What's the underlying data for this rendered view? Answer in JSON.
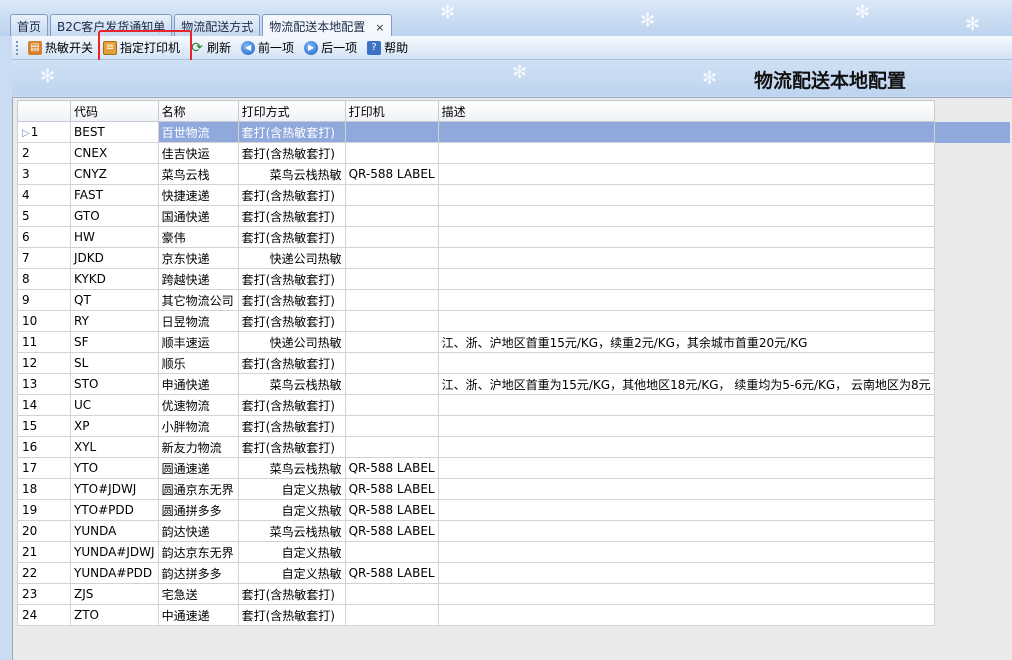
{
  "tabs": [
    {
      "label": "首页"
    },
    {
      "label": "B2C客户发货通知单"
    },
    {
      "label": "物流配送方式"
    },
    {
      "label": "物流配送本地配置",
      "active": true
    }
  ],
  "close_glyph": "×",
  "toolbar": {
    "hot_switch": "热敏开关",
    "assign_printer": "指定打印机",
    "refresh": "刷新",
    "prev": "前一项",
    "next": "后一项",
    "help": "帮助"
  },
  "page_title": "物流配送本地配置",
  "grid": {
    "columns": [
      "代码",
      "名称",
      "打印方式",
      "打印机",
      "描述"
    ],
    "selected_index": 0,
    "rows": [
      {
        "n": "1",
        "code": "BEST",
        "name": "百世物流",
        "method": "套打(含热敏套打)",
        "printer": "",
        "desc": ""
      },
      {
        "n": "2",
        "code": "CNEX",
        "name": "佳吉快运",
        "method": "套打(含热敏套打)",
        "printer": "",
        "desc": ""
      },
      {
        "n": "3",
        "code": "CNYZ",
        "name": "菜鸟云栈",
        "method": "菜鸟云栈热敏",
        "printer": "QR-588 LABEL",
        "desc": ""
      },
      {
        "n": "4",
        "code": "FAST",
        "name": "快捷速递",
        "method": "套打(含热敏套打)",
        "printer": "",
        "desc": ""
      },
      {
        "n": "5",
        "code": "GTO",
        "name": "国通快递",
        "method": "套打(含热敏套打)",
        "printer": "",
        "desc": ""
      },
      {
        "n": "6",
        "code": "HW",
        "name": "豪伟",
        "method": "套打(含热敏套打)",
        "printer": "",
        "desc": ""
      },
      {
        "n": "7",
        "code": "JDKD",
        "name": "京东快递",
        "method": "快递公司热敏",
        "printer": "",
        "desc": ""
      },
      {
        "n": "8",
        "code": "KYKD",
        "name": "跨越快递",
        "method": "套打(含热敏套打)",
        "printer": "",
        "desc": ""
      },
      {
        "n": "9",
        "code": "QT",
        "name": "其它物流公司",
        "method": "套打(含热敏套打)",
        "printer": "",
        "desc": ""
      },
      {
        "n": "10",
        "code": "RY",
        "name": "日昱物流",
        "method": "套打(含热敏套打)",
        "printer": "",
        "desc": ""
      },
      {
        "n": "11",
        "code": "SF",
        "name": "顺丰速运",
        "method": "快递公司热敏",
        "printer": "",
        "desc": "江、浙、沪地区首重15元/KG，续重2元/KG，其余城市首重20元/KG"
      },
      {
        "n": "12",
        "code": "SL",
        "name": "顺乐",
        "method": "套打(含热敏套打)",
        "printer": "",
        "desc": ""
      },
      {
        "n": "13",
        "code": "STO",
        "name": "申通快递",
        "method": "菜鸟云栈热敏",
        "printer": "",
        "desc": "江、浙、沪地区首重为15元/KG，其他地区18元/KG， 续重均为5-6元/KG， 云南地区为8元"
      },
      {
        "n": "14",
        "code": "UC",
        "name": "优速物流",
        "method": "套打(含热敏套打)",
        "printer": "",
        "desc": ""
      },
      {
        "n": "15",
        "code": "XP",
        "name": "小胖物流",
        "method": "套打(含热敏套打)",
        "printer": "",
        "desc": ""
      },
      {
        "n": "16",
        "code": "XYL",
        "name": "新友力物流",
        "method": "套打(含热敏套打)",
        "printer": "",
        "desc": ""
      },
      {
        "n": "17",
        "code": "YTO",
        "name": "圆通速递",
        "method": "菜鸟云栈热敏",
        "printer": "QR-588 LABEL",
        "desc": ""
      },
      {
        "n": "18",
        "code": "YTO#JDWJ",
        "name": "圆通京东无界",
        "method": "自定义热敏",
        "printer": "QR-588 LABEL",
        "desc": ""
      },
      {
        "n": "19",
        "code": "YTO#PDD",
        "name": "圆通拼多多",
        "method": "自定义热敏",
        "printer": "QR-588 LABEL",
        "desc": ""
      },
      {
        "n": "20",
        "code": "YUNDA",
        "name": "韵达快递",
        "method": "菜鸟云栈热敏",
        "printer": "QR-588 LABEL",
        "desc": ""
      },
      {
        "n": "21",
        "code": "YUNDA#JDWJ",
        "name": "韵达京东无界",
        "method": "自定义热敏",
        "printer": "",
        "desc": ""
      },
      {
        "n": "22",
        "code": "YUNDA#PDD",
        "name": "韵达拼多多",
        "method": "自定义热敏",
        "printer": "QR-588 LABEL",
        "desc": ""
      },
      {
        "n": "23",
        "code": "ZJS",
        "name": "宅急送",
        "method": "套打(含热敏套打)",
        "printer": "",
        "desc": ""
      },
      {
        "n": "24",
        "code": "ZTO",
        "name": "中通速递",
        "method": "套打(含热敏套打)",
        "printer": "",
        "desc": ""
      }
    ]
  },
  "colors": {
    "selected_row": "#8fa9dc",
    "highlight_box": "#e8252b",
    "background": "#c9dcf2"
  }
}
